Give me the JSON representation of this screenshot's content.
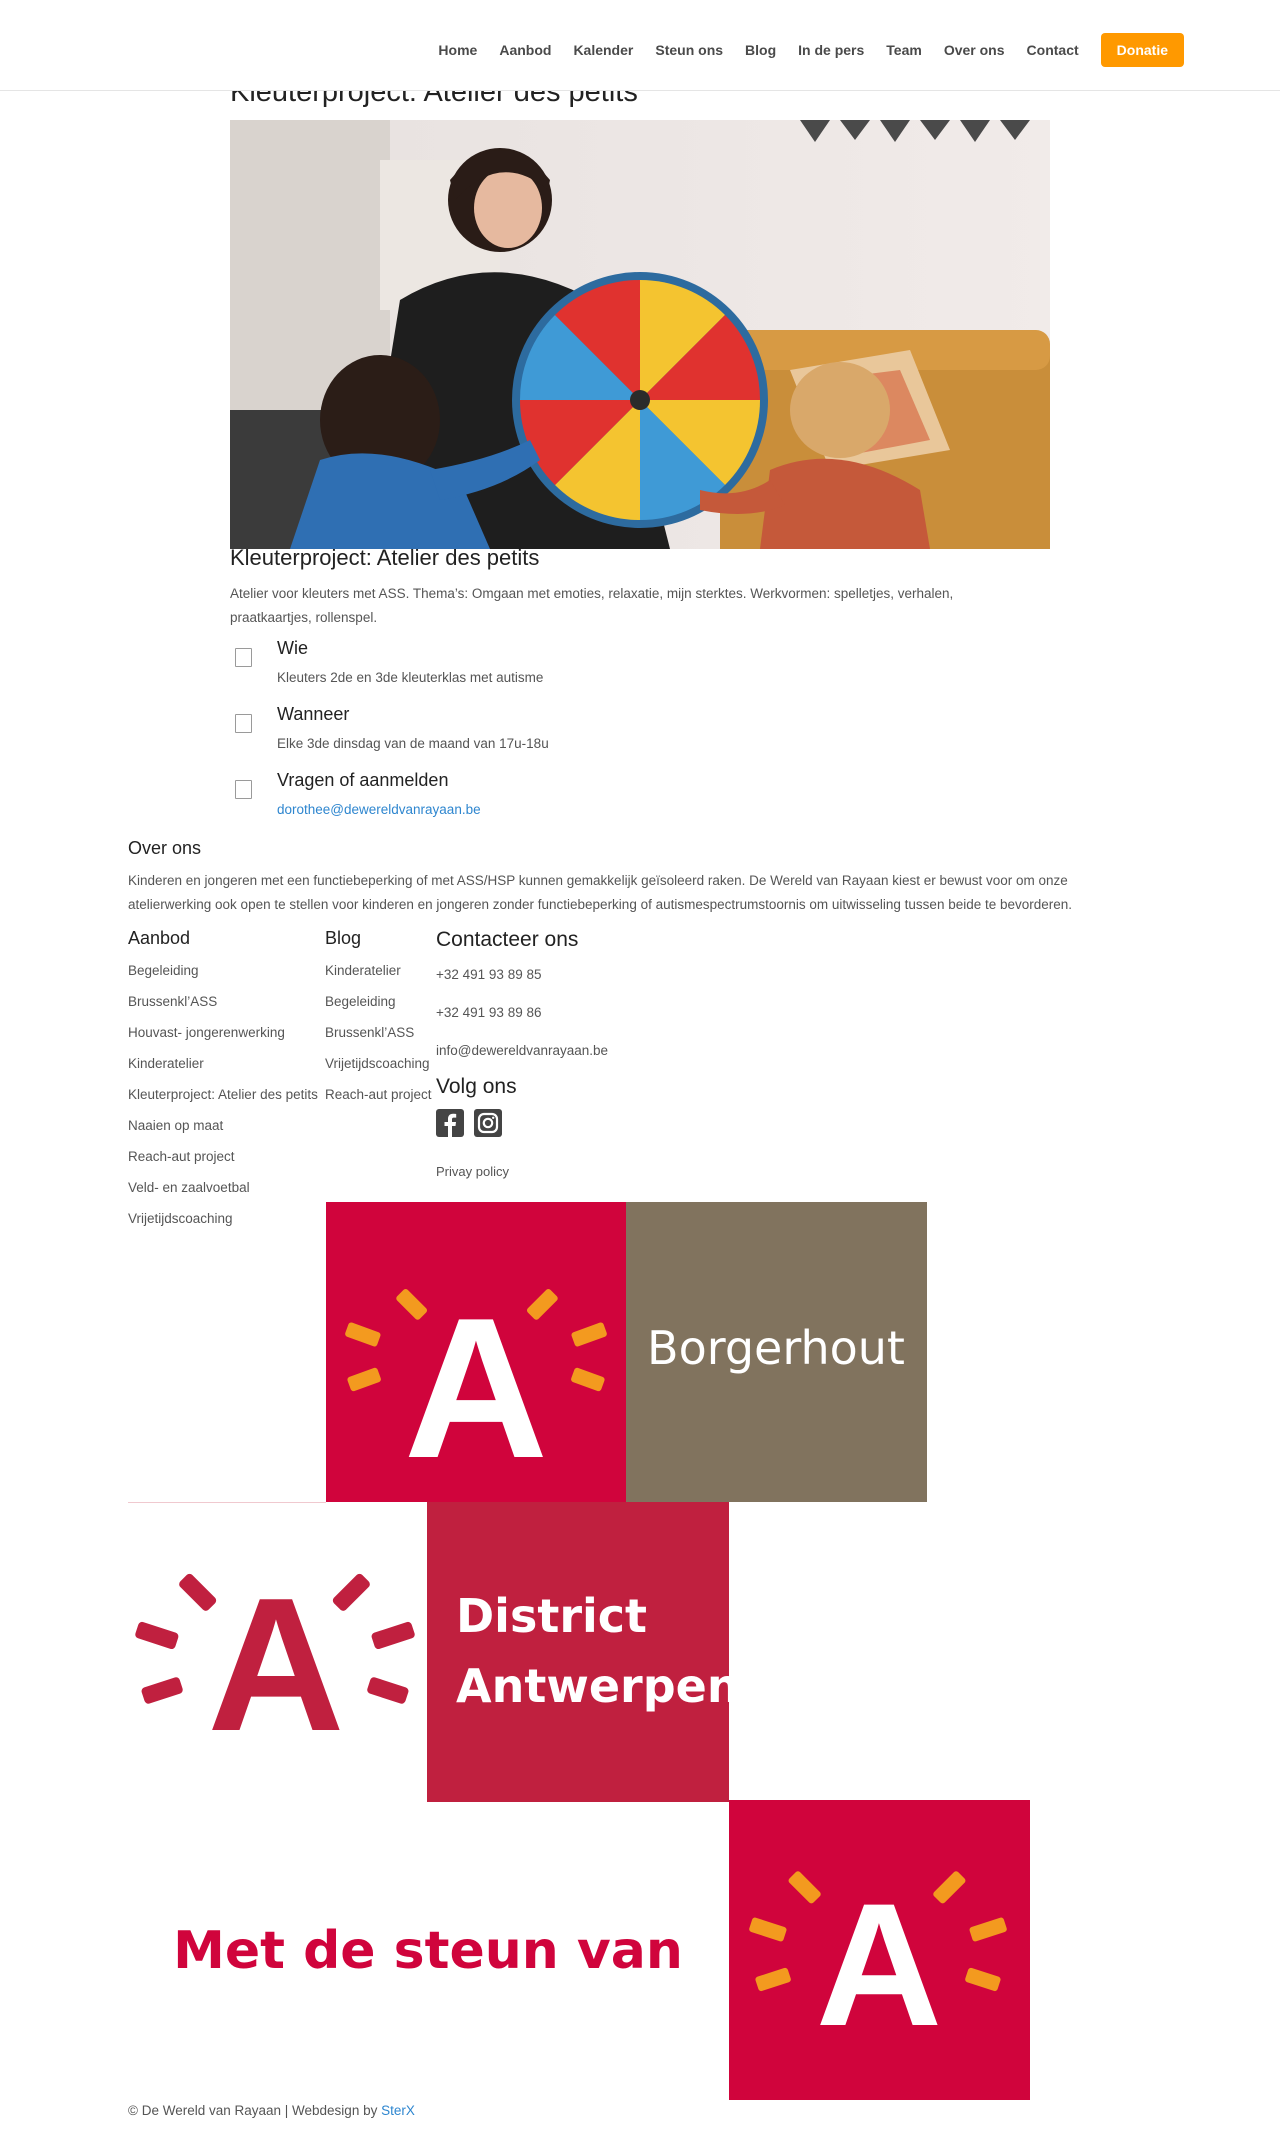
{
  "nav": {
    "items": [
      "Home",
      "Aanbod",
      "Kalender",
      "Steun ons",
      "Blog",
      "In de pers",
      "Team",
      "Over ons",
      "Contact"
    ],
    "cta": "Donatie",
    "accent": "#ff9900"
  },
  "page": {
    "title": "Kleuterproject: Atelier des petits",
    "section_title": "Kleuterproject: Atelier des petits",
    "intro": "Atelier voor kleuters met ASS. Thema’s: Omgaan met emoties, relaxatie, mijn sterktes. Werkvormen: spelletjes, verhalen, praatkaartjes, rollenspel."
  },
  "info": {
    "who_label": "Wie",
    "who_value": "Kleuters 2de en 3de kleuterklas met autisme",
    "when_label": "Wanneer",
    "when_value": "Elke 3de dinsdag van de maand van 17u-18u",
    "apply_label": "Vragen of aanmelden",
    "apply_value": "dorothee@dewereldvanrayaan.be"
  },
  "about": {
    "title": "Over ons",
    "text": "Kinderen en jongeren met een functiebeperking of met ASS/HSP kunnen gemakkelijk geïsoleerd raken. De Wereld van Rayaan kiest er bewust voor om onze atelierwerking ook open te stellen voor kinderen en jongeren zonder functiebeperking of autismespectrumstoornis om uitwisseling tussen beide te bevorderen."
  },
  "footer": {
    "aanbod_title": "Aanbod",
    "aanbod_items": [
      "Begeleiding",
      "Brussenkl’ASS",
      "Houvast- jongerenwerking",
      "Kinderatelier",
      "Kleuterproject: Atelier des petits",
      "Naaien op maat",
      "Reach-aut project",
      "Veld- en zaalvoetbal",
      "Vrijetijdscoaching"
    ],
    "blog_title": "Blog",
    "blog_items": [
      "Kinderatelier",
      "Begeleiding",
      "Brussenkl’ASS",
      "Vrijetijdscoaching",
      "Reach-aut project"
    ],
    "contact_title": "Contacteer ons",
    "phone1": "+32 491 93 89 85",
    "phone2": "+32 491 93 89 86",
    "email": "info@dewereldvanrayaan.be",
    "follow_title": "Volg ons",
    "privacy": "Privay policy",
    "social_icons": [
      "facebook-icon",
      "instagram-icon"
    ]
  },
  "sponsors": {
    "borgerhout": "Borgerhout",
    "district_line1": "District",
    "district_line2": "Antwerpen",
    "steun": "Met de steun van",
    "logo_letter": "A",
    "red": "#d0043c",
    "brown": "#81735e",
    "crimson": "#c0203f"
  },
  "copyright": {
    "text": "© De Wereld van Rayaan | Webdesign by ",
    "link": "SterX"
  }
}
